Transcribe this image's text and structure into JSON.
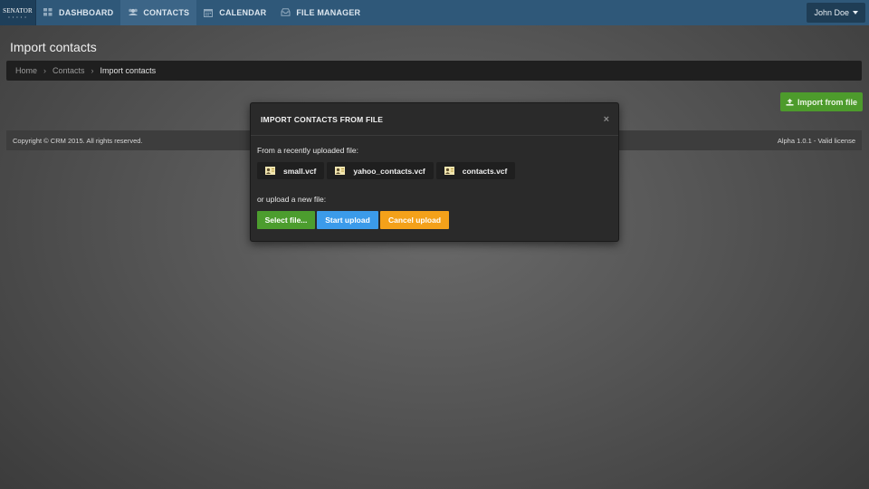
{
  "navbar": {
    "brand": "SENATOR",
    "brand_dots": "• • • • •",
    "items": [
      {
        "label": "DASHBOARD",
        "icon": "grid-icon"
      },
      {
        "label": "CONTACTS",
        "icon": "users-icon",
        "active": true
      },
      {
        "label": "CALENDAR",
        "icon": "calendar-icon"
      },
      {
        "label": "FILE MANAGER",
        "icon": "inbox-icon"
      }
    ],
    "user": "John Doe"
  },
  "page": {
    "title": "Import contacts",
    "breadcrumb": [
      "Home",
      "Contacts",
      "Import contacts"
    ],
    "import_button": "Import from file"
  },
  "footer": {
    "copyright": "Copyright © CRM 2015. All rights reserved.",
    "version": "Alpha 1.0.1 - Valid license"
  },
  "modal": {
    "title": "IMPORT CONTACTS FROM FILE",
    "close": "×",
    "recent_label": "From a recently uploaded file:",
    "files": [
      "small.vcf",
      "yahoo_contacts.vcf",
      "contacts.vcf"
    ],
    "upload_label": "or upload a new file:",
    "buttons": {
      "select": "Select file...",
      "start": "Start upload",
      "cancel": "Cancel upload"
    }
  },
  "colors": {
    "navbar": "#2f5879",
    "green": "#4c9d2e",
    "blue": "#3b9bea",
    "orange": "#f4a11a"
  }
}
